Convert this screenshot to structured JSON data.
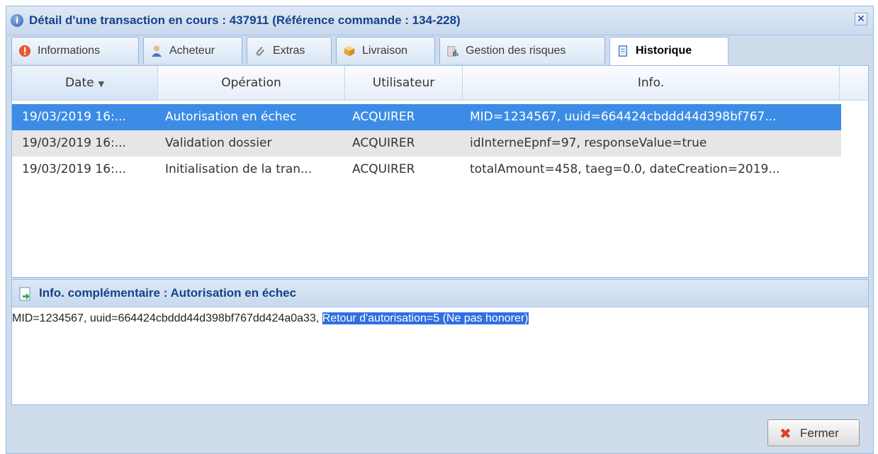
{
  "window": {
    "title": "Détail d'une transaction en cours : 437911 (Référence commande : 134-228)",
    "close_label": "✕"
  },
  "tabs": [
    {
      "label": "Informations",
      "icon": "warning-icon"
    },
    {
      "label": "Acheteur",
      "icon": "user-icon"
    },
    {
      "label": "Extras",
      "icon": "paperclip-icon"
    },
    {
      "label": "Livraison",
      "icon": "box-icon"
    },
    {
      "label": "Gestion des risques",
      "icon": "chart-icon"
    },
    {
      "label": "Historique",
      "icon": "scroll-icon",
      "active": true
    }
  ],
  "grid": {
    "columns": [
      "Date",
      "Opération",
      "Utilisateur",
      "Info."
    ],
    "sort_indicator": "▼",
    "rows": [
      {
        "date": "19/03/2019 16:...",
        "operation": "Autorisation en échec",
        "user": "ACQUIRER",
        "info": "MID=1234567, uuid=664424cbddd44d398bf767..."
      },
      {
        "date": "19/03/2019 16:...",
        "operation": "Validation dossier",
        "user": "ACQUIRER",
        "info": "idInterneEpnf=97, responseValue=true"
      },
      {
        "date": "19/03/2019 16:...",
        "operation": "Initialisation de la tran...",
        "user": "ACQUIRER",
        "info": "totalAmount=458, taeg=0.0, dateCreation=2019..."
      }
    ]
  },
  "details": {
    "title": "Info. complémentaire : Autorisation en échec",
    "text_plain": "MID=1234567, uuid=664424cbddd44d398bf767dd424a0a33, ",
    "text_highlighted": "Retour d'autorisation=5 (Ne pas honorer)"
  },
  "footer": {
    "close_button": "Fermer"
  },
  "colors": {
    "accent": "#15428b",
    "selection": "#3c8ce6"
  }
}
